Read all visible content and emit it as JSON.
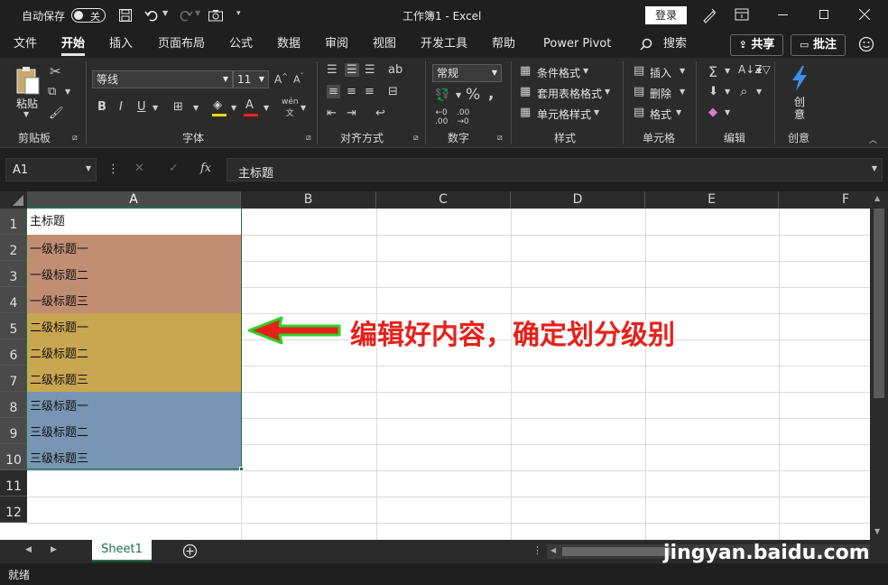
{
  "titlebar": {
    "autosave_label": "自动保存",
    "autosave_state": "关",
    "title": "工作簿1  -  Excel",
    "login_label": "登录"
  },
  "tabs": [
    "文件",
    "开始",
    "插入",
    "页面布局",
    "公式",
    "数据",
    "审阅",
    "视图",
    "开发工具",
    "帮助",
    "Power Pivot"
  ],
  "active_tab": "开始",
  "search_label": "搜索",
  "share_label": "共享",
  "comment_label": "批注",
  "ribbon": {
    "paste_label": "粘贴",
    "font_name": "等线",
    "font_size": "11",
    "number_format": "常规",
    "conditional_format": "条件格式",
    "table_format": "套用表格格式",
    "cell_style": "单元格样式",
    "insert": "插入",
    "delete": "删除",
    "format": "格式",
    "create": "创\n意",
    "groups": [
      "剪贴板",
      "字体",
      "对齐方式",
      "数字",
      "样式",
      "单元格",
      "编辑",
      "创意"
    ]
  },
  "formula_bar": {
    "name_box": "A1",
    "formula": "主标题"
  },
  "columns": [
    "A",
    "B",
    "C",
    "D",
    "E",
    "F"
  ],
  "rows": [
    "1",
    "2",
    "3",
    "4",
    "5",
    "6",
    "7",
    "8",
    "9",
    "10",
    "11",
    "12"
  ],
  "cells": [
    {
      "row": 1,
      "text": "主标题",
      "fill": "#ffffff"
    },
    {
      "row": 2,
      "text": "一级标题一",
      "fill": "#c28e73"
    },
    {
      "row": 3,
      "text": "一级标题二",
      "fill": "#c28e73"
    },
    {
      "row": 4,
      "text": "一级标题三",
      "fill": "#c28e73"
    },
    {
      "row": 5,
      "text": "二级标题一",
      "fill": "#c9a650"
    },
    {
      "row": 6,
      "text": "二级标题二",
      "fill": "#c9a650"
    },
    {
      "row": 7,
      "text": "二级标题三",
      "fill": "#c9a650"
    },
    {
      "row": 8,
      "text": "三级标题一",
      "fill": "#7896b3"
    },
    {
      "row": 9,
      "text": "三级标题二",
      "fill": "#7896b3"
    },
    {
      "row": 10,
      "text": "三级标题三",
      "fill": "#7896b3"
    }
  ],
  "annotation": "编辑好内容，确定划分级别",
  "sheet_tab": "Sheet1",
  "status_text": "就绪",
  "watermark": "jingyan.baidu.com"
}
